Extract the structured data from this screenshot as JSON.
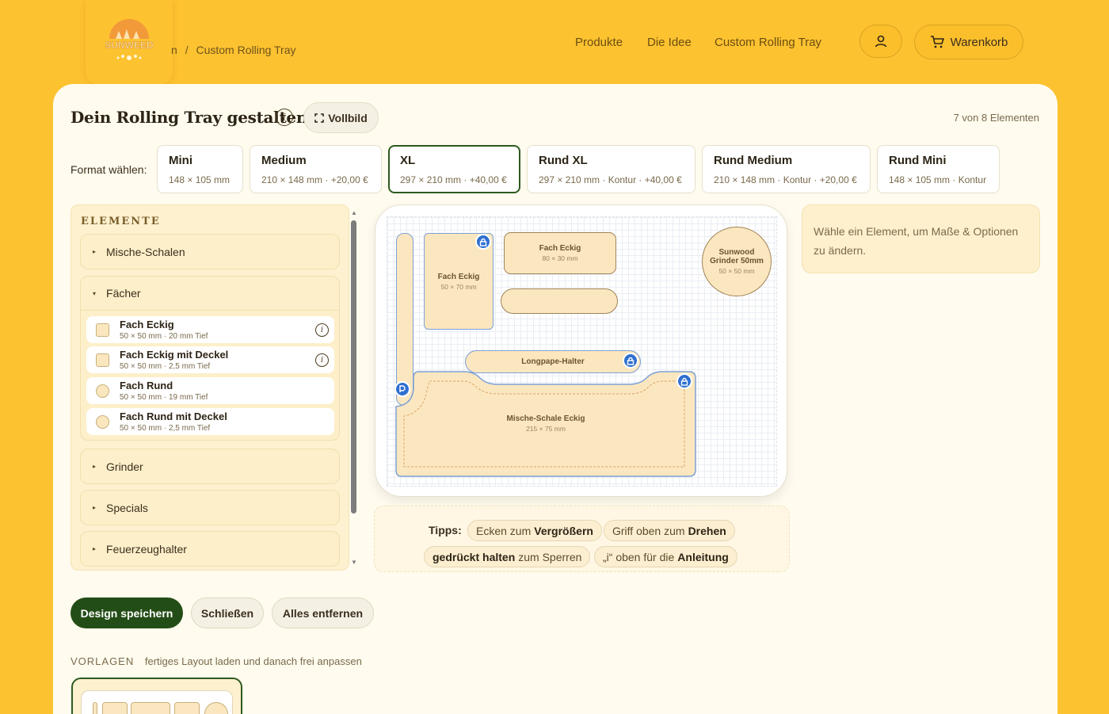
{
  "header": {
    "logo_text": "SUNWEED",
    "breadcrumb": {
      "prev": "n",
      "separator": "/",
      "current": "Custom Rolling Tray"
    },
    "nav": [
      "Produkte",
      "Die Idee",
      "Custom Rolling Tray"
    ],
    "cart_label": "Warenkorb",
    "user_icon": "user-icon",
    "cart_icon": "cart-icon"
  },
  "designer": {
    "title": "Dein Rolling Tray gestalten",
    "fullscreen_label": "Vollbild",
    "element_count": "7 von 8 Elementen",
    "format_label": "Format wählen:",
    "formats": [
      {
        "name": "Mini",
        "detail": "148 × 105 mm"
      },
      {
        "name": "Medium",
        "detail": "210 × 148 mm · +20,00 €"
      },
      {
        "name": "XL",
        "detail": "297 × 210 mm · +40,00 €",
        "selected": true
      },
      {
        "name": "Rund XL",
        "detail": "297 × 210 mm · Kontur · +40,00 €"
      },
      {
        "name": "Rund Medium",
        "detail": "210 × 148 mm · Kontur · +20,00 €"
      },
      {
        "name": "Rund Mini",
        "detail": "148 × 105 mm · Kontur"
      }
    ]
  },
  "elements_panel": {
    "title": "ELEMENTE",
    "groups": [
      {
        "label": "Mische-Schalen",
        "expanded": false
      },
      {
        "label": "Fächer",
        "expanded": true,
        "items": [
          {
            "name": "Fach Eckig",
            "detail": "50 × 50 mm · 20 mm Tief",
            "shape": "square",
            "info": true
          },
          {
            "name": "Fach Eckig mit Deckel",
            "detail": "50 × 50 mm · 2,5 mm Tief",
            "shape": "square",
            "info": true
          },
          {
            "name": "Fach Rund",
            "detail": "50 × 50 mm · 19 mm Tief",
            "shape": "round",
            "info": false
          },
          {
            "name": "Fach Rund mit Deckel",
            "detail": "50 × 50 mm · 2,5 mm Tief",
            "shape": "round",
            "info": false
          }
        ]
      },
      {
        "label": "Grinder",
        "expanded": false
      },
      {
        "label": "Specials",
        "expanded": false
      },
      {
        "label": "Feuerzeughalter",
        "expanded": false
      }
    ]
  },
  "canvas": {
    "shapes": [
      {
        "name": "Fach Eckig",
        "detail": "50 × 70 mm",
        "locked": true
      },
      {
        "name": "Fach Eckig",
        "detail": "80 × 30 mm",
        "locked": false
      },
      {
        "name": "Sunwood Grinder 50mm",
        "detail": "50 × 50 mm",
        "locked": false
      },
      {
        "name": "Longpape-Halter",
        "detail": "",
        "locked": true
      },
      {
        "name": "Mische-Schale Eckig",
        "detail": "215 × 75 mm",
        "locked": true
      }
    ]
  },
  "hint": "Wähle ein Element, um Maße & Optionen zu ändern.",
  "tips": {
    "label": "Tipps:",
    "items": [
      {
        "pre": "Ecken zum",
        "bold": "Vergrößern",
        "post": ""
      },
      {
        "pre": "Griff oben zum",
        "bold": "Drehen",
        "post": ""
      },
      {
        "pre": "",
        "bold": "gedrückt halten",
        "post": "zum Sperren"
      },
      {
        "pre": "„i“ oben für die",
        "bold": "Anleitung",
        "post": ""
      }
    ]
  },
  "actions": {
    "save": "Design speichern",
    "close": "Schließen",
    "remove_all": "Alles entfernen"
  },
  "templates": {
    "caption": "VORLAGEN",
    "description": "fertiges Layout laden und danach frei anpassen"
  },
  "colors": {
    "background": "#fdc230",
    "card": "#fffbee",
    "primary": "#234d16",
    "lock": "#2f6fd1",
    "element_fill": "#fbe7bf"
  }
}
